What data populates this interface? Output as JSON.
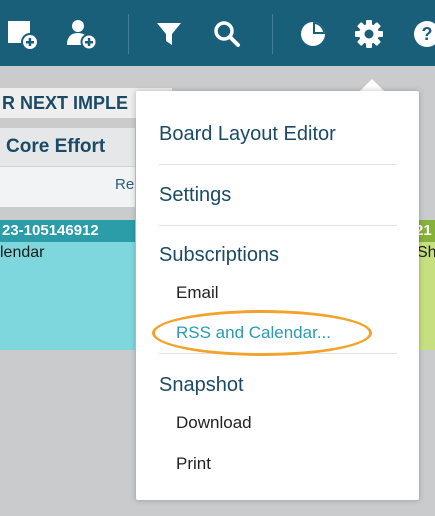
{
  "toolbar": {
    "buttons": [
      {
        "name": "add-card-icon"
      },
      {
        "name": "add-user-icon"
      },
      {
        "name": "filter-icon"
      },
      {
        "name": "search-icon"
      },
      {
        "name": "chart-icon"
      },
      {
        "name": "settings-gear-icon"
      },
      {
        "name": "help-icon"
      }
    ]
  },
  "board": {
    "lane_title": "R NEXT IMPLE",
    "lane_header": "Core Effort",
    "column_partial": "Re",
    "card": {
      "id": "23-105146912",
      "text": "lendar"
    },
    "card2": {
      "id": "21",
      "text": "Sh"
    }
  },
  "menu": {
    "board_layout_editor": "Board Layout Editor",
    "settings": "Settings",
    "subscriptions": "Subscriptions",
    "email": "Email",
    "rss_calendar": "RSS and Calendar...",
    "snapshot": "Snapshot",
    "download": "Download",
    "print": "Print"
  },
  "colors": {
    "toolbar": "#195f7a",
    "accent_link": "#2a9bb0",
    "highlight": "#f2a32b"
  }
}
